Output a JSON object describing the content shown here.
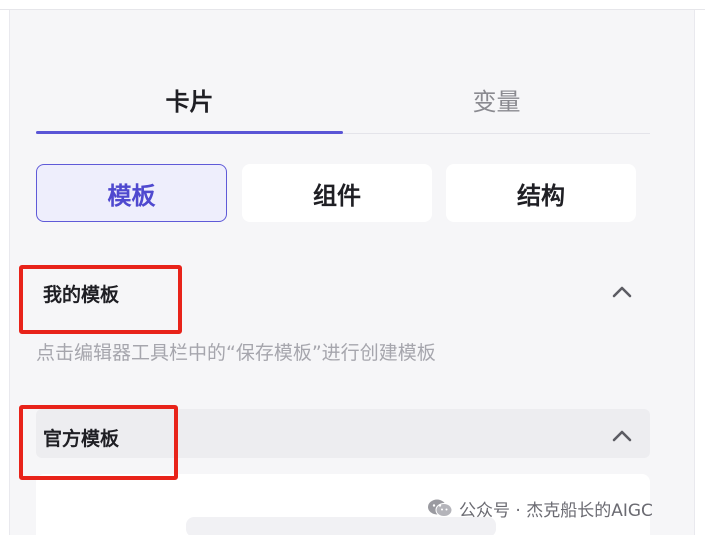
{
  "tabs": [
    {
      "label": "卡片",
      "active": true
    },
    {
      "label": "变量",
      "active": false
    }
  ],
  "segments": [
    {
      "label": "模板",
      "active": true
    },
    {
      "label": "组件",
      "active": false
    },
    {
      "label": "结构",
      "active": false
    }
  ],
  "my_templates": {
    "title": "我的模板",
    "hint": "点击编辑器工具栏中的“保存模板”进行创建模板",
    "expanded_icon": "chevron-up-icon"
  },
  "official_templates": {
    "title": "官方模板",
    "expanded_icon": "chevron-up-icon"
  },
  "watermark": {
    "text": "公众号 · 杰克船长的AIGC",
    "icon": "wechat-icon"
  },
  "colors": {
    "accent": "#5a55d6",
    "highlight": "#e8231a",
    "panel_bg": "#f6f6f8"
  }
}
